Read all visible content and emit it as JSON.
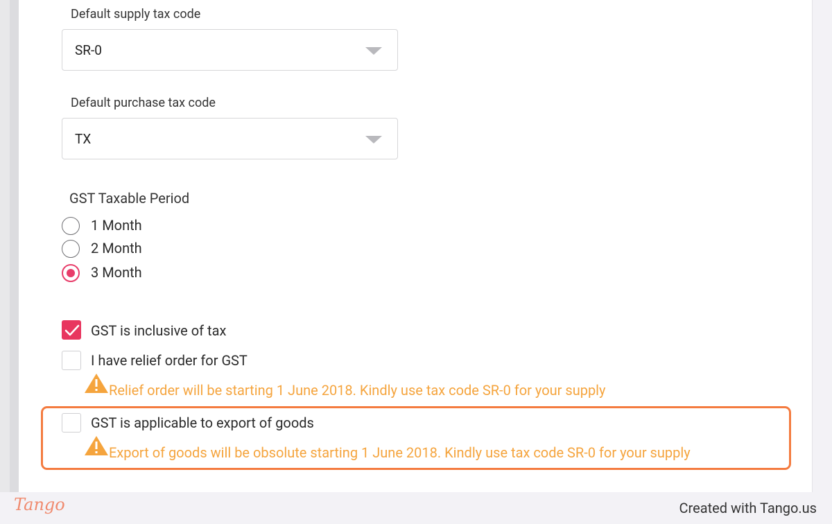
{
  "form": {
    "supply_tax": {
      "label": "Default supply tax code",
      "value": "SR-0"
    },
    "purchase_tax": {
      "label": "Default purchase tax code",
      "value": "TX"
    },
    "taxable_period": {
      "title": "GST Taxable Period",
      "options": [
        {
          "label": "1 Month",
          "selected": false
        },
        {
          "label": "2 Month",
          "selected": false
        },
        {
          "label": "3 Month",
          "selected": true
        }
      ]
    },
    "checkboxes": [
      {
        "label": "GST is inclusive of tax",
        "checked": true
      },
      {
        "label": "I have relief order for GST",
        "checked": false,
        "warning": "Relief order will be starting 1 June 2018. Kindly use tax code SR-0 for your supply"
      },
      {
        "label": "GST is applicable to export of goods",
        "checked": false,
        "warning": "Export of goods will be obsolute starting 1 June 2018. Kindly use tax code SR-0 for your supply"
      }
    ]
  },
  "colors": {
    "accent": "#e8365f",
    "warning": "#f5a43d",
    "highlight": "#f47b3f"
  },
  "footer": {
    "logo": "Tango",
    "credit": "Created with Tango.us"
  }
}
